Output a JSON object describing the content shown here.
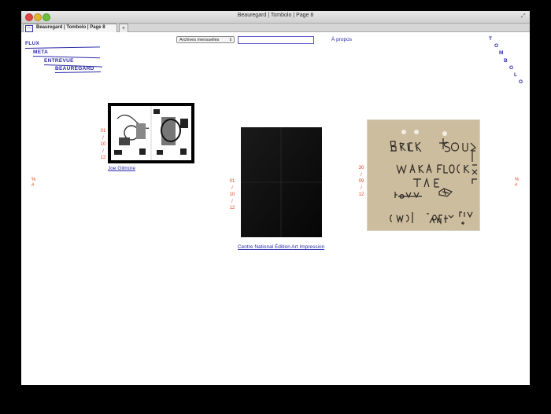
{
  "window": {
    "title": "Beauregard | Tombolo | Page 8",
    "tab_label": "Beauregard | Tombolo | Page 8",
    "new_tab_symbol": "+"
  },
  "nav": {
    "items": [
      "FLUX",
      "META",
      "ENTREVUE",
      "BEAUREGARD"
    ]
  },
  "toolbar": {
    "archives_label": "Archives mensuelles",
    "search_value": "",
    "apropos_label": "À propos"
  },
  "brand": {
    "letters": [
      "T",
      "O",
      "M",
      "B",
      "O",
      "L",
      "O"
    ]
  },
  "pager": {
    "prev": [
      "%",
      "#"
    ],
    "next": [
      "%",
      "#"
    ]
  },
  "posts": [
    {
      "date": [
        "01",
        "/",
        "10",
        "/",
        "12"
      ],
      "caption": "Joe Gilmore"
    },
    {
      "date": [
        "01",
        "/",
        "10",
        "/",
        "12"
      ],
      "caption": "Centre National Édition Art Impression"
    },
    {
      "date": [
        "30",
        "/",
        "09",
        "/",
        "12"
      ],
      "caption": ""
    }
  ],
  "colors": {
    "link": "#2a2aa8",
    "date": "#e8401c",
    "background": "#000000"
  }
}
